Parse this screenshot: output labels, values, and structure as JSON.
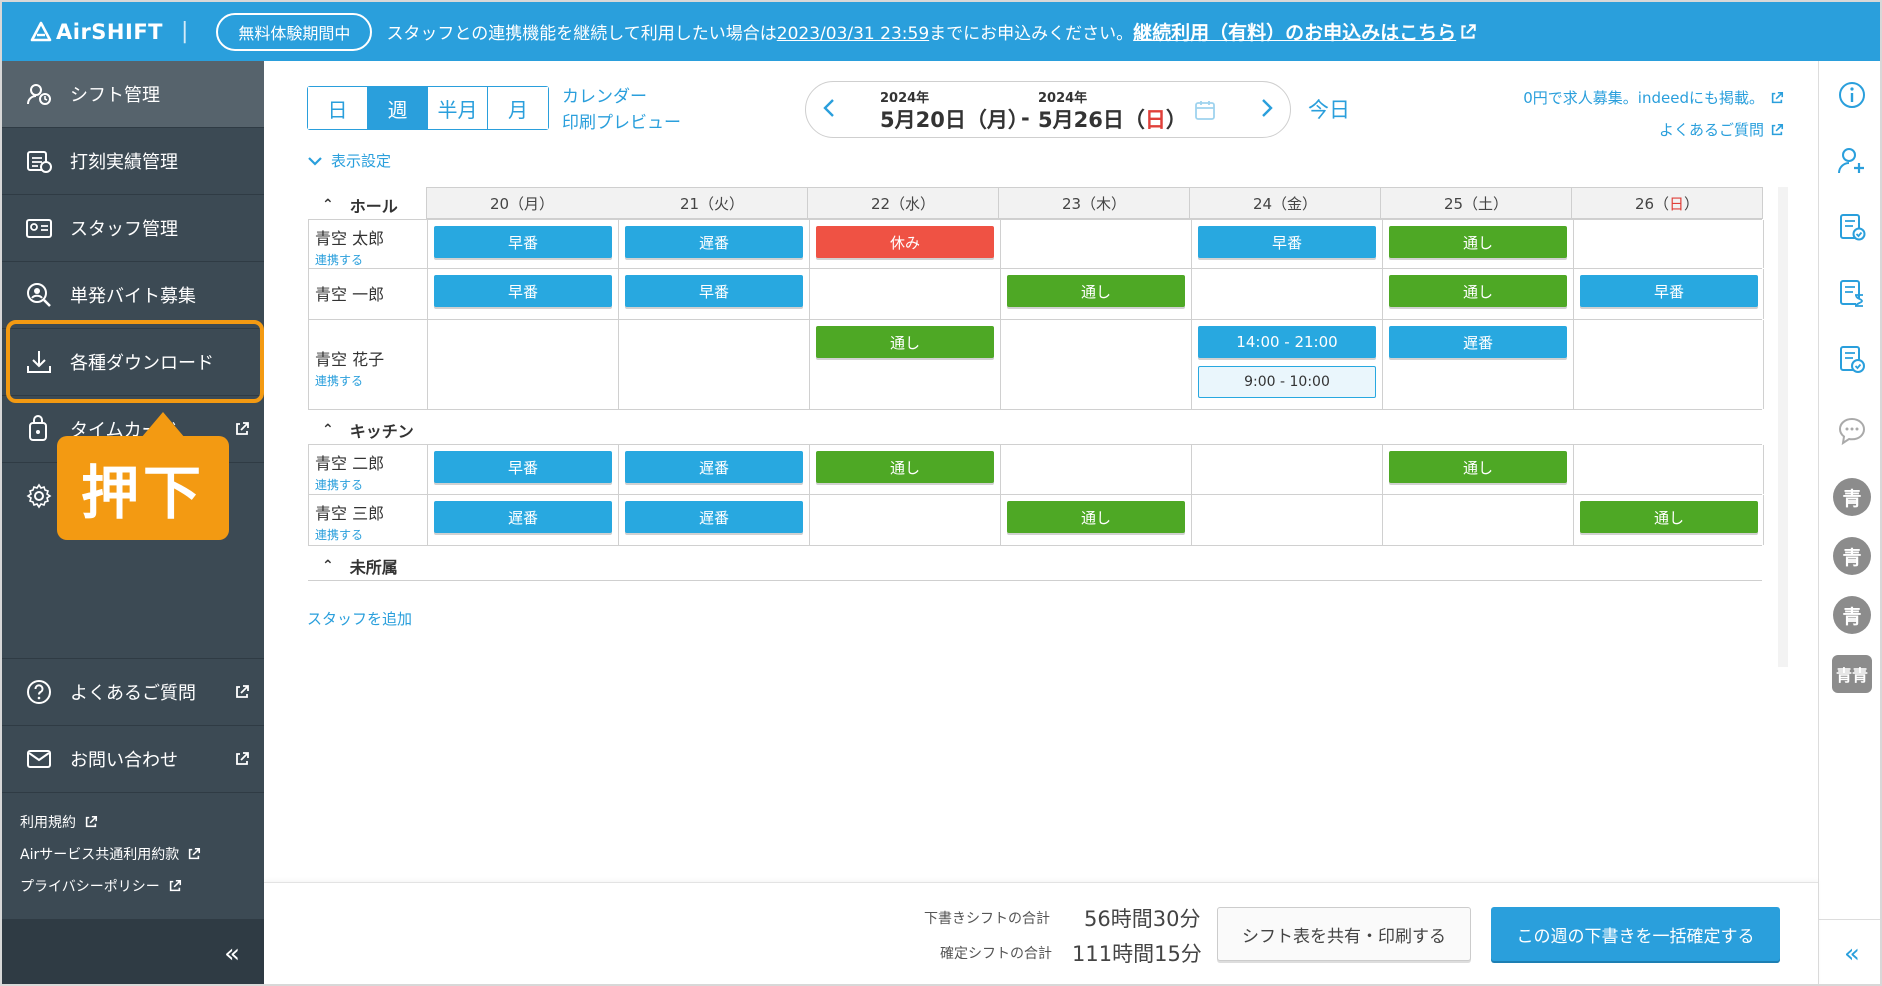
{
  "banner": {
    "app_name": "AirSHIFT",
    "trial_badge": "無料体験期間中",
    "notice_prefix": "スタッフとの連携機能を継続して利用したい場合は",
    "notice_deadline": "2023/03/31 23:59",
    "notice_suffix": "までにお申込みください。",
    "notice_link": "継続利用（有料）のお申込みはこちら"
  },
  "sidebar": {
    "items": [
      {
        "label": "シフト管理",
        "icon": "shift-icon"
      },
      {
        "label": "打刻実績管理",
        "icon": "clock-record-icon"
      },
      {
        "label": "スタッフ管理",
        "icon": "id-card-icon"
      },
      {
        "label": "単発バイト募集",
        "icon": "person-search-icon"
      },
      {
        "label": "各種ダウンロード",
        "icon": "download-icon"
      },
      {
        "label": "タイムカード",
        "icon": "timecard-icon"
      },
      {
        "label": "",
        "icon": "gear-icon"
      }
    ],
    "help": "よくあるご質問",
    "contact": "お問い合わせ",
    "legal": [
      "利用規約",
      "Airサービス共通利用約款",
      "プライバシーポリシー"
    ],
    "collapse": "«"
  },
  "annotation": {
    "callout": "押下"
  },
  "toolbar": {
    "tabs": [
      "日",
      "週",
      "半月",
      "月"
    ],
    "active_tab": "週",
    "calendar_print_line1": "カレンダー",
    "calendar_print_line2": "印刷プレビュー",
    "date_from_year": "2024年",
    "date_from": "5月20日（月）",
    "date_sep": "-",
    "date_to_year": "2024年",
    "date_to_main": "5月26日（",
    "date_to_day": "日",
    "date_to_close": "）",
    "today": "今日",
    "recruit_link": "0円で求人募集。indeedにも掲載。",
    "faq_link": "よくあるご質問",
    "display_settings": "表示設定"
  },
  "schedule": {
    "days": [
      {
        "date": "20（月）",
        "holiday": false
      },
      {
        "date": "21（火）",
        "holiday": false
      },
      {
        "date": "22（水）",
        "holiday": false
      },
      {
        "date": "23（木）",
        "holiday": false
      },
      {
        "date": "24（金）",
        "holiday": false
      },
      {
        "date": "25（土）",
        "holiday": false
      },
      {
        "date": "26（日）",
        "holiday": true
      }
    ],
    "groups": [
      {
        "name": "ホール"
      },
      {
        "name": "キッチン"
      },
      {
        "name": "未所属"
      }
    ],
    "link_label": "連携する",
    "staff": [
      {
        "name": "青空 太郎",
        "linked": true,
        "shifts": [
          [
            "早番"
          ],
          [
            "遅番"
          ],
          [
            "休み"
          ],
          [],
          [
            "早番"
          ],
          [
            "通し"
          ],
          []
        ]
      },
      {
        "name": "青空 一郎",
        "linked": false,
        "shifts": [
          [
            "早番"
          ],
          [
            "早番"
          ],
          [],
          [
            "通し"
          ],
          [],
          [
            "通し"
          ],
          [
            "早番"
          ]
        ]
      },
      {
        "name": "青空 花子",
        "linked": true,
        "shifts": [
          [],
          [],
          [
            "通し"
          ],
          [],
          [
            "14:00 - 21:00",
            "9:00 - 10:00"
          ],
          [
            "遅番"
          ],
          []
        ]
      },
      {
        "name": "青空 二郎",
        "linked": true,
        "shifts": [
          [
            "早番"
          ],
          [
            "遅番"
          ],
          [
            "通し"
          ],
          [],
          [],
          [
            "通し"
          ],
          []
        ]
      },
      {
        "name": "青空 三郎",
        "linked": true,
        "shifts": [
          [
            "遅番"
          ],
          [
            "遅番"
          ],
          [],
          [
            "通し"
          ],
          [],
          [],
          [
            "通し"
          ]
        ]
      }
    ],
    "add_staff": "スタッフを追加"
  },
  "footer": {
    "draft_label": "下書きシフトの合計",
    "draft_value": "56時間30分",
    "confirmed_label": "確定シフトの合計",
    "confirmed_value": "111時間15分",
    "share_button": "シフト表を共有・印刷する",
    "confirm_button": "この週の下書きを一括確定する"
  },
  "right_rail": {
    "icons": [
      "info-icon",
      "add-user-icon",
      "document-check-icon",
      "document-hourglass-icon",
      "document-approve-icon",
      "chat-icon"
    ],
    "avatars": [
      "青",
      "青",
      "青",
      "青青"
    ],
    "collapse": "«"
  },
  "colors": {
    "brand": "#2a9fdc",
    "sidebar": "#3c4a54",
    "shift_blue": "#28a8e0",
    "shift_green": "#4ea825",
    "shift_red": "#ef5244",
    "highlight": "#f39a12"
  }
}
